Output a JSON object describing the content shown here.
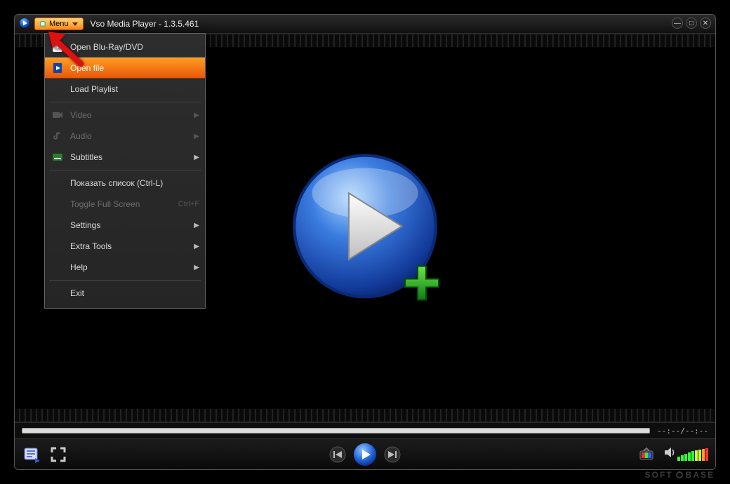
{
  "titlebar": {
    "menu_button_label": "Menu",
    "app_title": "Vso Media Player - 1.3.5.461"
  },
  "menu": {
    "items": [
      {
        "label": "Open Blu-Ray/DVD",
        "icon": "disc-icon",
        "enabled": true,
        "submenu": false,
        "selected": false
      },
      {
        "label": "Open file",
        "icon": "file-play-icon",
        "enabled": true,
        "submenu": false,
        "selected": true
      },
      {
        "label": "Load Playlist",
        "icon": "",
        "enabled": true,
        "submenu": false,
        "selected": false
      }
    ],
    "items2": [
      {
        "label": "Video",
        "icon": "video-icon",
        "enabled": false,
        "submenu": true
      },
      {
        "label": "Audio",
        "icon": "note-icon",
        "enabled": false,
        "submenu": true
      },
      {
        "label": "Subtitles",
        "icon": "subtitle-icon",
        "enabled": true,
        "submenu": true
      }
    ],
    "items3": [
      {
        "label": "Показать список (Ctrl-L)",
        "enabled": true,
        "submenu": false
      },
      {
        "label": "Toggle Full Screen",
        "enabled": false,
        "submenu": false,
        "shortcut": "Ctrl+F"
      },
      {
        "label": "Settings",
        "enabled": true,
        "submenu": true
      },
      {
        "label": "Extra Tools",
        "enabled": true,
        "submenu": true
      },
      {
        "label": "Help",
        "enabled": true,
        "submenu": true
      }
    ],
    "items4": [
      {
        "label": "Exit",
        "enabled": true,
        "submenu": false
      }
    ]
  },
  "seek": {
    "time_display": "--:--/--:--"
  },
  "watermark": {
    "left": "SOFT",
    "right": "BASE"
  }
}
